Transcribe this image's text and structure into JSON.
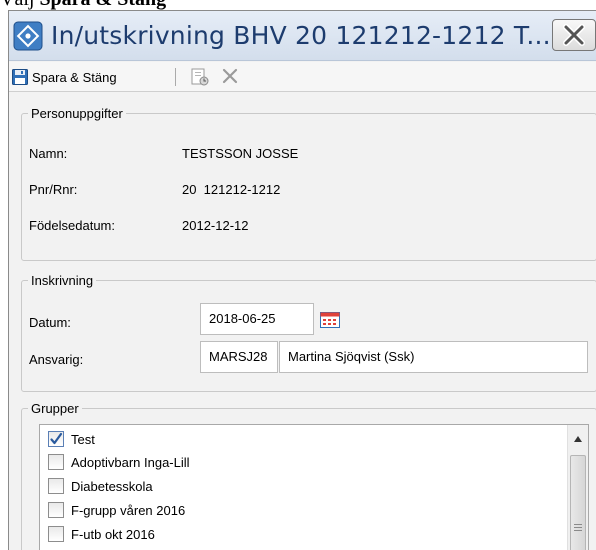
{
  "doc": {
    "heading_prefix": "Välj",
    "heading_bold": "Spara & Stäng"
  },
  "window": {
    "title": "In/utskrivning BHV 20 121212-1212 T..."
  },
  "toolbar": {
    "save_label": "Spara & Stäng"
  },
  "personuppgifter": {
    "legend": "Personuppgifter",
    "rows": [
      {
        "label": "Namn:",
        "value": "TESTSSON JOSSE"
      },
      {
        "label": "Pnr/Rnr:",
        "value": "20  121212-1212"
      },
      {
        "label": "Födelsedatum:",
        "value": "2012-12-12"
      }
    ]
  },
  "inskrivning": {
    "legend": "Inskrivning",
    "datum_label": "Datum:",
    "datum_value": "2018-06-25",
    "ansvarig_label": "Ansvarig:",
    "ansvarig_code": "MARSJ28",
    "ansvarig_name": "Martina Sjöqvist (Ssk)"
  },
  "grupper": {
    "legend": "Grupper",
    "items": [
      {
        "label": "Test",
        "checked": true
      },
      {
        "label": "Adoptivbarn Inga-Lill",
        "checked": false
      },
      {
        "label": "Diabetesskola",
        "checked": false
      },
      {
        "label": "F-grupp våren 2016",
        "checked": false
      },
      {
        "label": "F-utb okt 2016",
        "checked": false
      }
    ]
  },
  "icons": {
    "app": "info-icon",
    "close": "close-icon",
    "save": "floppy-disk-icon",
    "note": "note-icon",
    "delete": "x-icon",
    "calendar": "calendar-icon",
    "scroll_up": "arrow-up-icon"
  },
  "colors": {
    "title_text": "#1d3c6e",
    "accent": "#2f6fb7",
    "check": "#2a5a9e"
  }
}
